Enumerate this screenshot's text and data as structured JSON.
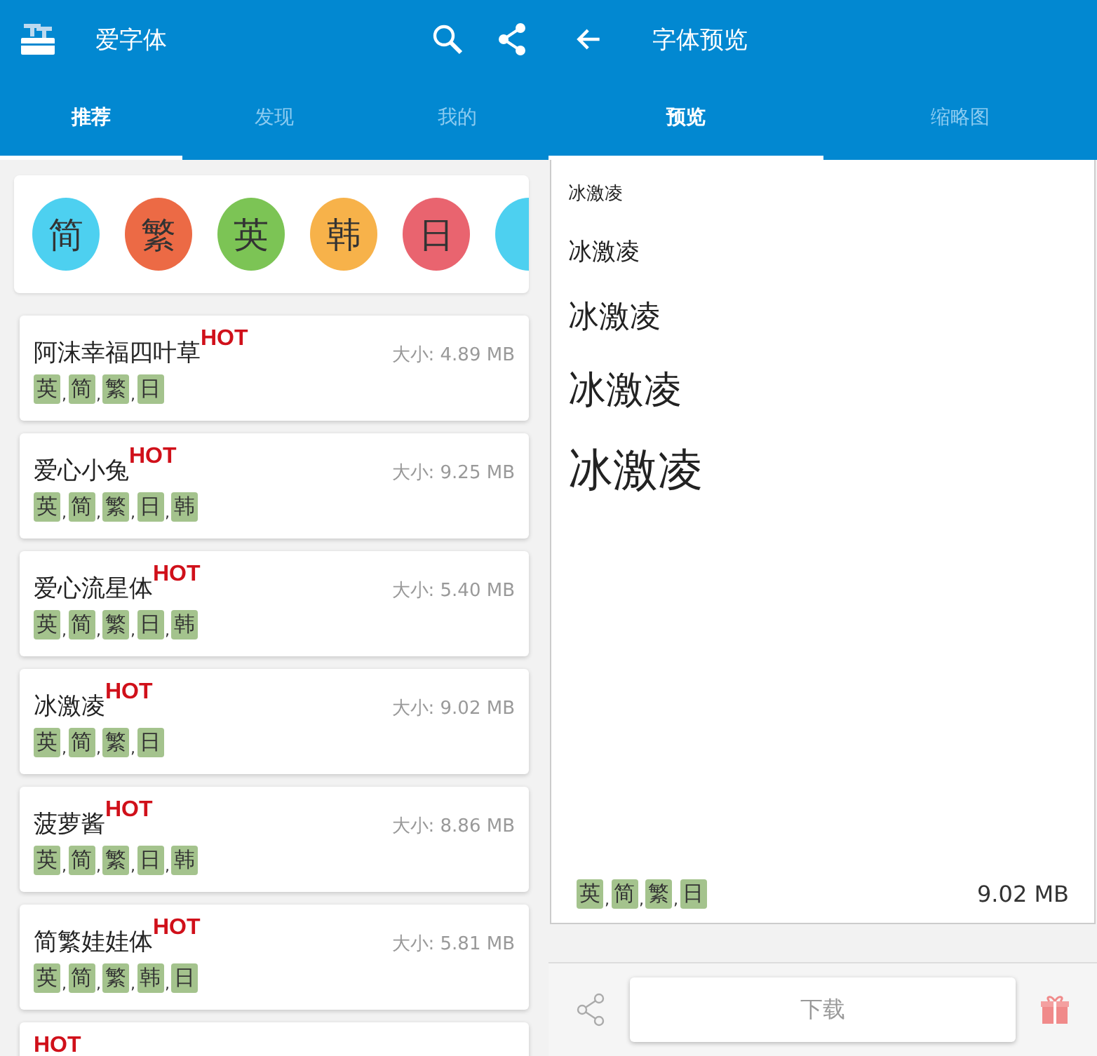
{
  "tag_separator": ",",
  "left": {
    "app_bar": {
      "title": "爱字体"
    },
    "tabs": [
      {
        "label": "推荐",
        "selected": true
      },
      {
        "label": "发现",
        "selected": false
      },
      {
        "label": "我的",
        "selected": false
      }
    ],
    "categories": [
      {
        "label": "简",
        "color": "#4dd0f0"
      },
      {
        "label": "繁",
        "color": "#ec6a45"
      },
      {
        "label": "英",
        "color": "#7cc455"
      },
      {
        "label": "韩",
        "color": "#f7b24a"
      },
      {
        "label": "日",
        "color": "#e9646f"
      },
      {
        "color": "#4dd0f0"
      }
    ],
    "fonts": [
      {
        "name": "阿沫幸福四叶草",
        "hot": "HOT",
        "size": "大小: 4.89 MB",
        "tags": [
          "英",
          "简",
          "繁",
          "日"
        ]
      },
      {
        "name": "爱心小兔",
        "hot": "HOT",
        "size": "大小: 9.25 MB",
        "tags": [
          "英",
          "简",
          "繁",
          "日",
          "韩"
        ]
      },
      {
        "name": "爱心流星体",
        "hot": "HOT",
        "size": "大小: 5.40 MB",
        "tags": [
          "英",
          "简",
          "繁",
          "日",
          "韩"
        ]
      },
      {
        "name": "冰激凌",
        "hot": "HOT",
        "size": "大小: 9.02 MB",
        "tags": [
          "英",
          "简",
          "繁",
          "日"
        ]
      },
      {
        "name": "菠萝酱",
        "hot": "HOT",
        "size": "大小: 8.86 MB",
        "tags": [
          "英",
          "简",
          "繁",
          "日",
          "韩"
        ]
      },
      {
        "name": "简繁娃娃体",
        "hot": "HOT",
        "size": "大小: 5.81 MB",
        "tags": [
          "英",
          "简",
          "繁",
          "韩",
          "日"
        ]
      },
      {
        "hot": "HOT"
      }
    ]
  },
  "right": {
    "app_bar": {
      "title": "字体预览"
    },
    "tabs": [
      {
        "label": "预览",
        "selected": true
      },
      {
        "label": "缩略图",
        "selected": false
      }
    ],
    "samples": [
      "冰激凌",
      "冰激凌",
      "冰激凌",
      "冰激凌",
      "冰激凌"
    ],
    "tags": [
      "英",
      "简",
      "繁",
      "日"
    ],
    "size": "9.02 MB",
    "download_button": "下载"
  }
}
